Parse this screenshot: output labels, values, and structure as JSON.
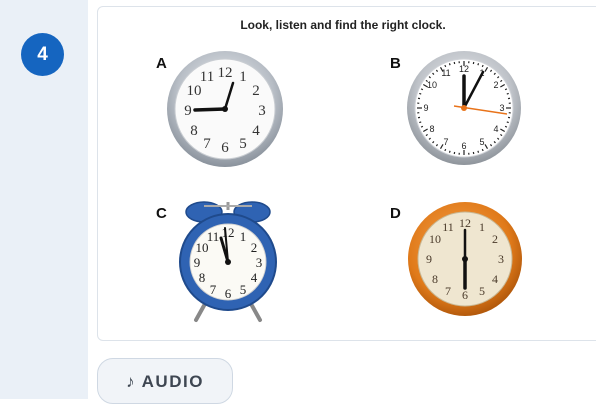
{
  "question": {
    "number": "4",
    "instruction": "Look, listen and find the right clock."
  },
  "options": [
    {
      "letter": "A",
      "clock": "silver wall clock",
      "time": "9:05"
    },
    {
      "letter": "B",
      "clock": "white wall clock",
      "time": "12:00"
    },
    {
      "letter": "C",
      "clock": "blue alarm clock",
      "time": "11:56"
    },
    {
      "letter": "D",
      "clock": "orange wall clock",
      "time": "6:00"
    }
  ],
  "audio": {
    "icon": "music-note-icon",
    "label": "AUDIO",
    "symbol": "♪"
  },
  "colors": {
    "accent": "#1565c0",
    "strip": "#eaf0f7",
    "alarm_blue": "#2f63b3",
    "orange_rim": "#e07a1a"
  }
}
